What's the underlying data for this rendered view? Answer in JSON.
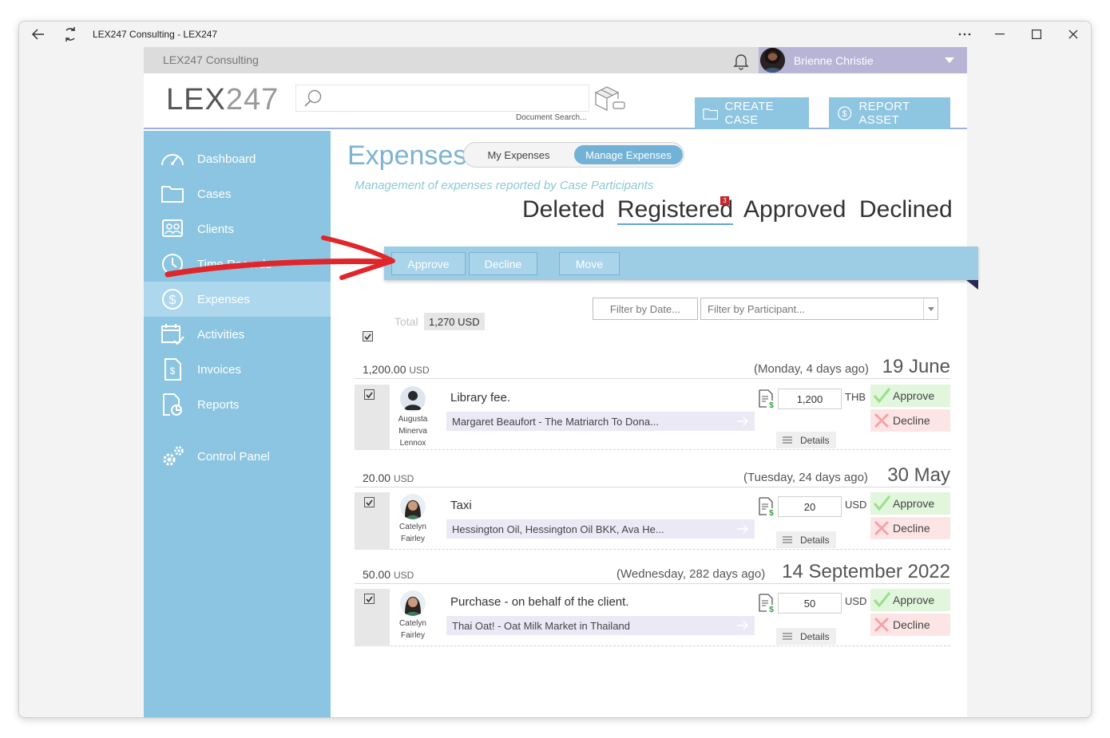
{
  "window": {
    "title": "LEX247 Consulting - LEX247"
  },
  "topbar": {
    "company": "LEX247 Consulting",
    "user_name": "Brienne Christie"
  },
  "header": {
    "logo_main": "LEX",
    "logo_thin": "247",
    "search_placeholder": "",
    "search_caption": "Document Search...",
    "create_case": "CREATE CASE",
    "report_asset": "REPORT ASSET"
  },
  "sidebar": {
    "items": [
      {
        "label": "Dashboard",
        "icon": "dashboard-icon"
      },
      {
        "label": "Cases",
        "icon": "folder-icon"
      },
      {
        "label": "Clients",
        "icon": "clients-icon"
      },
      {
        "label": "Time Records",
        "icon": "clock-icon"
      },
      {
        "label": "Expenses",
        "icon": "dollar-icon"
      },
      {
        "label": "Activities",
        "icon": "calendar-icon"
      },
      {
        "label": "Invoices",
        "icon": "invoice-icon"
      },
      {
        "label": "Reports",
        "icon": "report-icon"
      },
      {
        "label": "Control Panel",
        "icon": "gears-icon"
      }
    ]
  },
  "main": {
    "title": "Expenses",
    "segment": {
      "left": "My Expenses",
      "right": "Manage Expenses"
    },
    "subtitle": "Management of expenses reported by Case Participants",
    "status_tabs": {
      "deleted": "Deleted",
      "registered": "Registered",
      "approved": "Approved",
      "declined": "Declined",
      "registered_badge": "3"
    },
    "actions": {
      "approve": "Approve",
      "decline": "Decline",
      "move": "Move"
    },
    "filters": {
      "date": "Filter by Date...",
      "participant": "Filter by Participant..."
    },
    "total_label": "Total",
    "total_value": "1,270 USD"
  },
  "groups": [
    {
      "amount": "1,200.00",
      "currency": "USD",
      "ago": "(Monday, 4 days ago)",
      "date": "19 June",
      "row": {
        "name_lines": [
          "Augusta",
          "Minerva",
          "Lennox"
        ],
        "description": "Library fee.",
        "case": "Margaret Beaufort - The Matriarch To Dona...",
        "amount": "1,200",
        "currency": "THB",
        "details": "Details",
        "approve": "Approve",
        "decline": "Decline"
      }
    },
    {
      "amount": "20.00",
      "currency": "USD",
      "ago": "(Tuesday, 24 days ago)",
      "date": "30 May",
      "row": {
        "name_lines": [
          "Catelyn",
          "Fairley"
        ],
        "description": "Taxi",
        "case": "Hessington Oil, Hessington Oil BKK, Ava He...",
        "amount": "20",
        "currency": "USD",
        "details": "Details",
        "approve": "Approve",
        "decline": "Decline"
      }
    },
    {
      "amount": "50.00",
      "currency": "USD",
      "ago": "(Wednesday, 282 days ago)",
      "date": "14 September 2022",
      "row": {
        "name_lines": [
          "Catelyn",
          "Fairley"
        ],
        "description": "Purchase - on behalf of the client.",
        "case": "Thai Oat! - Oat Milk Market in Thailand",
        "amount": "50",
        "currency": "USD",
        "details": "Details",
        "approve": "Approve",
        "decline": "Decline"
      }
    }
  ],
  "colors": {
    "sidebar": "#8cc5e1",
    "sidebar_active": "#acd7ec",
    "accent": "#72b2d6",
    "arrow": "#e0262b"
  }
}
